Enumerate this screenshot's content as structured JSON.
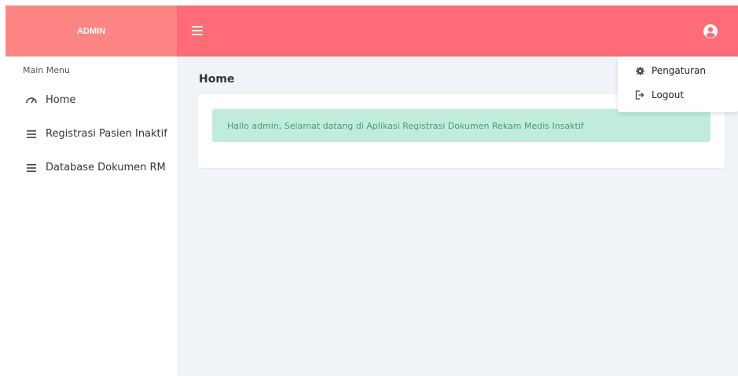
{
  "brand": {
    "title": "ADMIN"
  },
  "colors": {
    "brand_bg": "#ff8484",
    "navbar_bg": "#ff6b76",
    "alert_bg": "#c1ecdb",
    "alert_text": "#3f9e76",
    "main_bg": "#f0f4f8"
  },
  "sidebar": {
    "heading": "Main Menu",
    "items": [
      {
        "label": "Home",
        "icon": "dashboard-gauge-icon"
      },
      {
        "label": "Registrasi Pasien Inaktif",
        "icon": "list-icon"
      },
      {
        "label": "Database Dokumen RM",
        "icon": "list-icon"
      }
    ]
  },
  "main": {
    "title": "Home",
    "alert": "Hallo admin, Selamat datang di Aplikasi Registrasi Dokumen Rekam Medis Insaktif"
  },
  "user_menu": {
    "icon": "user-circle-icon",
    "items": [
      {
        "label": "Pengaturan",
        "icon": "gear-icon"
      },
      {
        "label": "Logout",
        "icon": "logout-icon"
      }
    ]
  }
}
